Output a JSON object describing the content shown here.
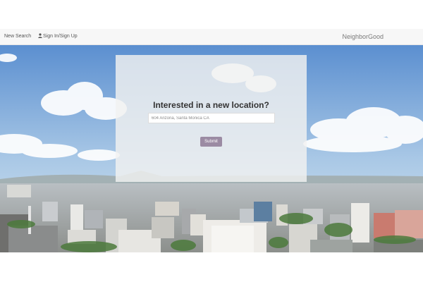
{
  "navbar": {
    "new_search_label": "New Search",
    "signin_label": "Sign In/Sign Up",
    "brand": "NeighborGood"
  },
  "search": {
    "heading": "Interested in a new location?",
    "input_value": "",
    "placeholder": "604 Arizona, Santa Monica CA",
    "submit_label": "Submit"
  },
  "colors": {
    "navbar_bg": "#f7f7f7",
    "brand_text": "#7a7a7a",
    "submit_bg": "#9b8ba3",
    "sky_top": "#5b8fd0",
    "sky_bottom": "#cfe1f0"
  },
  "icons": {
    "signin": "user-icon"
  }
}
